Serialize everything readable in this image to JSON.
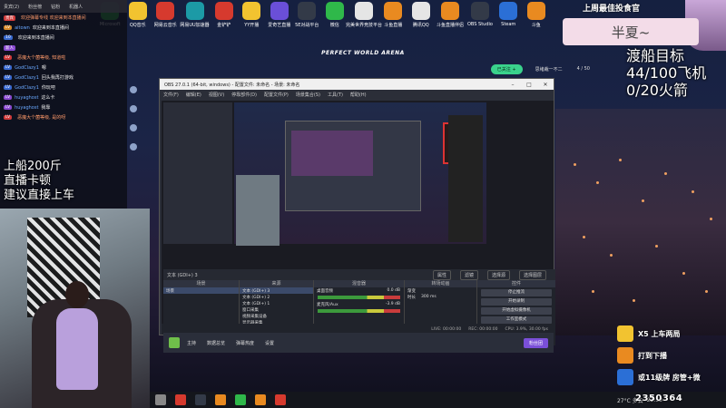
{
  "desktop": {
    "icons": [
      {
        "label": "Microsoft",
        "color": "green"
      },
      {
        "label": "QQ音乐",
        "color": "yellow"
      },
      {
        "label": "网易云音乐",
        "color": "red"
      },
      {
        "label": "网易UU加速器",
        "color": "teal"
      },
      {
        "label": "金铲铲",
        "color": "red"
      },
      {
        "label": "YY开播",
        "color": "yellow"
      },
      {
        "label": "爱奇艺直播",
        "color": "purple"
      },
      {
        "label": "5E对战平台",
        "color": "dark"
      },
      {
        "label": "微信",
        "color": "green"
      },
      {
        "label": "完美世界竞技平台",
        "color": "white"
      },
      {
        "label": "斗鱼直播",
        "color": "orange"
      },
      {
        "label": "腾讯QQ",
        "color": "white"
      },
      {
        "label": "斗鱼直播伴侣",
        "color": "orange"
      },
      {
        "label": "OBS Studio",
        "color": "dark"
      },
      {
        "label": "Steam",
        "color": "blue"
      },
      {
        "label": "斗鱼",
        "color": "orange"
      }
    ]
  },
  "page": {
    "banner": "PERFECT WORLD ARENA",
    "follow_label": "已关注 +",
    "streamer_name": "思绪裁一不二",
    "viewer_count": "4 / 50"
  },
  "chat": {
    "header": [
      "贵宾(2)",
      "粉丝榜",
      "钻粉",
      "机器人"
    ],
    "messages": [
      {
        "badge": "贵宾",
        "badge_color": "b-red",
        "user": "",
        "text": "欢迎弹幕专线 欢迎来到本直播间",
        "sys": true
      },
      {
        "badge": "LV",
        "badge_color": "b-orange",
        "user": "aitown",
        "text": "欢迎来到本直播间",
        "sys": false
      },
      {
        "badge": "10",
        "badge_color": "b-blue",
        "user": "",
        "text": "欢迎来到本直播间",
        "sys": false
      },
      {
        "badge": "新人",
        "badge_color": "b-purple",
        "user": "",
        "text": "",
        "sys": false
      },
      {
        "badge": "LV",
        "badge_color": "b-red",
        "user": "",
        "text": "恶魔大个菌等级, 知道啦",
        "sys": true
      },
      {
        "badge": "LV",
        "badge_color": "b-blue",
        "user": "GodClazy1",
        "text": "嗯",
        "sys": false
      },
      {
        "badge": "LV",
        "badge_color": "b-blue",
        "user": "GodClazy1",
        "text": "回头我再打游戏",
        "sys": false
      },
      {
        "badge": "LV",
        "badge_color": "b-blue",
        "user": "GodClazy1",
        "text": "你玩吧",
        "sys": false
      },
      {
        "badge": "LV",
        "badge_color": "b-purple",
        "user": "huyaghost",
        "text": "这么卡",
        "sys": false
      },
      {
        "badge": "LV",
        "badge_color": "b-purple",
        "user": "huyaghost",
        "text": "我靠",
        "sys": false
      },
      {
        "badge": "LV",
        "badge_color": "b-red",
        "user": "",
        "text": "恶魔大个菌等级, 是的呀",
        "sys": true
      }
    ]
  },
  "overlay": {
    "left_text": [
      "上船200斤",
      "直播卡顿",
      "建议直接上车"
    ],
    "right_banner": "上周最佳投食官",
    "name": "半夏~",
    "goal_lines": [
      "渡船目标",
      "44/100飞机",
      "0/20火箭"
    ]
  },
  "obs": {
    "title": "OBS 27.0.1 (64-bit, windows) - 配置文件: 未命名 - 场景: 未命名",
    "menu": [
      "文件(F)",
      "编辑(E)",
      "视图(V)",
      "停靠部件(D)",
      "配置文件(P)",
      "场景集合(S)",
      "工具(T)",
      "帮助(H)"
    ],
    "scene_label": "文本 (GDI+) 3",
    "mid_tabs": [
      "属性",
      "滤镜",
      "选择源",
      "选择图层"
    ],
    "docks": {
      "scenes_title": "场景",
      "scenes": [
        "场景"
      ],
      "sources_title": "来源",
      "sources": [
        "文本 (GDI+) 3",
        "文本 (GDI+) 2",
        "文本 (GDI+) 1",
        "窗口采集",
        "视频采集设备",
        "显示器采集"
      ],
      "mixer_title": "混音器",
      "mixer": [
        "桌面音频",
        "麦克风/Aux"
      ],
      "mixer_levels": [
        "0.0 dB",
        "-3.9 dB"
      ],
      "transitions_title": "转场动画",
      "transition_type": "渐变",
      "transition_duration_label": "时长",
      "transition_duration": "300 ms",
      "controls_title": "控件",
      "controls": [
        "停止推流",
        "开始录制",
        "开始虚拟摄像机",
        "工作室模式",
        "设置",
        "退出"
      ]
    },
    "status": [
      "LIVE: 00:00:00",
      "REC: 00:00:00",
      "CPU: 3.9%, 30.00 fps"
    ]
  },
  "page_bottom": {
    "items": [
      "主持",
      "数据总览",
      "弹幕热度",
      "设置"
    ],
    "right_button": "粉丝团"
  },
  "rewards": [
    {
      "text": "X5 上车两局",
      "color": "yellow"
    },
    {
      "text": "打到下播",
      "color": "orange"
    },
    {
      "text": "或11级牌 房管+微",
      "color": "blue"
    }
  ],
  "taskbar": {
    "temp": "27°C 多云",
    "time": "22:53",
    "id_number": "2350364"
  }
}
